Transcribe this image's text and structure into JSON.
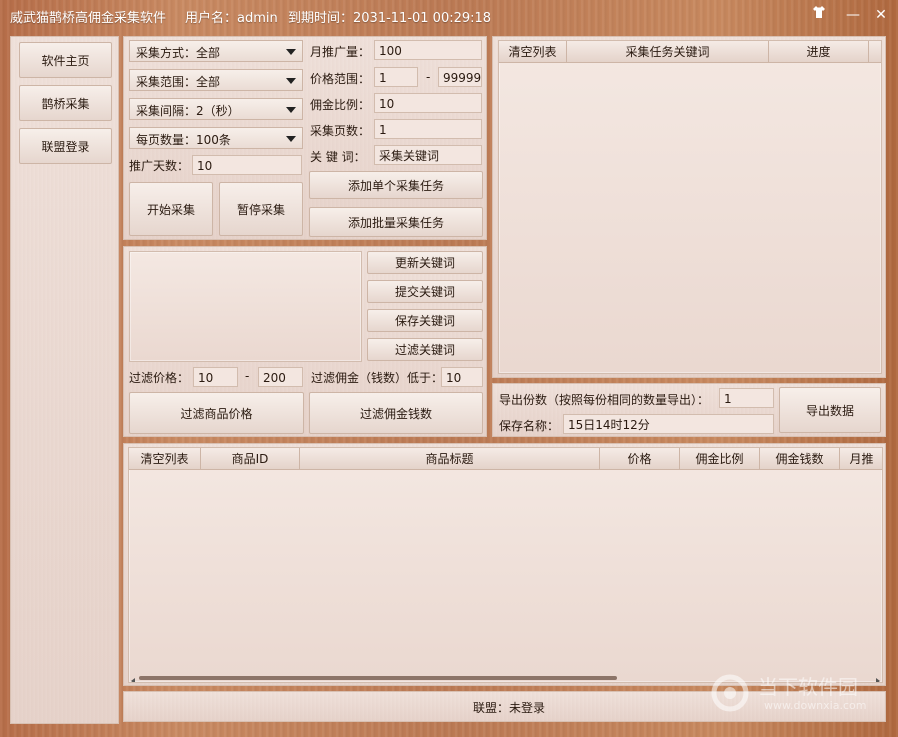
{
  "titlebar": {
    "app_title": "威武猫鹊桥高佣金采集软件",
    "user": "用户名：admin",
    "expire": "到期时间：2031-11-01 00:29:18",
    "controls": {
      "skin": "skin-shirt-icon",
      "minimize": "—",
      "close": "✕"
    }
  },
  "sidebar": {
    "items": [
      {
        "label": "软件主页"
      },
      {
        "label": "鹊桥采集"
      },
      {
        "label": "联盟登录"
      }
    ]
  },
  "collect": {
    "method": "采集方式：全部",
    "range": "采集范围：全部",
    "interval": "采集间隔：2（秒）",
    "per_page": "每页数量：100条",
    "promo_days_label": "推广天数：",
    "promo_days": "10",
    "start_btn": "开始采集",
    "pause_btn": "暂停采集",
    "monthly_label": "月推广量：",
    "monthly": "100",
    "price_label": "价格范围：",
    "price_min": "1",
    "price_sep": "-",
    "price_max": "99999",
    "ratio_label": "佣金比例：",
    "ratio": "10",
    "pages_label": "采集页数：",
    "pages": "1",
    "keyword_label": "关 键 词：",
    "keyword": "采集关键词",
    "add_single": "添加单个采集任务",
    "add_batch": "添加批量采集任务"
  },
  "keywords": {
    "update": "更新关键词",
    "submit": "提交关键词",
    "save": "保存关键词",
    "filter": "过滤关键词",
    "filter_price_label": "过滤价格：",
    "filter_price_min": "10",
    "filter_price_sep": "-",
    "filter_price_max": "200",
    "filter_comm_label": "过滤佣金（钱数）低于：",
    "filter_comm": "10",
    "filter_price_btn": "过滤商品价格",
    "filter_comm_btn": "过滤佣金钱数"
  },
  "task_table": {
    "headers": [
      "清空列表",
      "采集任务关键词",
      "进度"
    ]
  },
  "export": {
    "copies_label": "导出份数（按照每份相同的数量导出）：",
    "copies": "1",
    "name_label": "保存名称：",
    "name": "15日14时12分",
    "export_btn": "导出数据"
  },
  "product_table": {
    "headers": [
      "清空列表",
      "商品ID",
      "商品标题",
      "价格",
      "佣金比例",
      "佣金钱数",
      "月推"
    ]
  },
  "status": {
    "text": "联盟：未登录"
  },
  "watermark": {
    "text": "当下软件园",
    "url": "www.downxia.com"
  }
}
